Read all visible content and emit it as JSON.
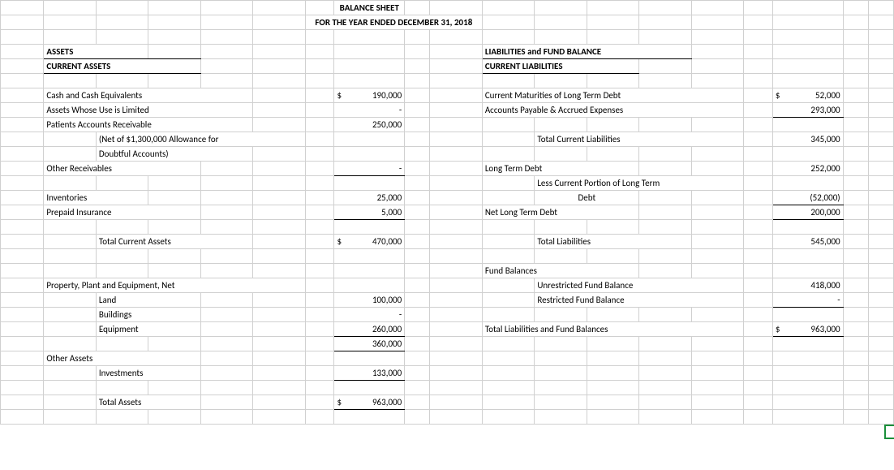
{
  "title": "BALANCE SHEET",
  "subtitle": "FOR THE YEAR ENDED DECEMBER 31, 2018",
  "left": {
    "h1": "ASSETS",
    "h2": "CURRENT ASSETS",
    "cash": "Cash and Cash Equivalents",
    "cash_dol": "$",
    "cash_v": "190,000",
    "ltd": "Assets Whose Use is Limited",
    "ltd_v": "-",
    "par": "Patients Accounts Receivable",
    "par_v": "250,000",
    "parNote1": "(Net of $1,300,000 Allowance for",
    "parNote2": "Doubtful Accounts)",
    "orec": "Other Receivables",
    "orec_v": "-",
    "inv": "Inventories",
    "inv_v": "25,000",
    "prep": "Prepaid Insurance",
    "prep_v": "5,000",
    "tca": "Total Current Assets",
    "tca_dol": "$",
    "tca_v": "470,000",
    "ppe": "Property, Plant and Equipment, Net",
    "land": "Land",
    "land_v": "100,000",
    "bld": "Buildings",
    "bld_v": "-",
    "eq": "Equipment",
    "eq_v": "260,000",
    "ppe_tot": "360,000",
    "oa": "Other Assets",
    "invst": "Investments",
    "invst_v": "133,000",
    "ta": "Total Assets",
    "ta_dol": "$",
    "ta_v": "963,000"
  },
  "right": {
    "h1": "LIABILITIES and FUND BALANCE",
    "h2": "CURRENT LIABILITIES",
    "cmltd": "Current Maturities of Long Term Debt",
    "cmltd_dol": "$",
    "cmltd_v": "52,000",
    "ap": "Accounts Payable & Accrued Expenses",
    "ap_v": "293,000",
    "tcl": "Total Current Liabilities",
    "tcl_v": "345,000",
    "ltdH": "Long Term Debt",
    "ltdH_v": "252,000",
    "lcp1": "Less Current Portion of Long Term",
    "lcp2": "Debt",
    "lcp_v": "(52,000)",
    "nltd": "Net Long Term Debt",
    "nltd_v": "200,000",
    "tl": "Total Liabilities",
    "tl_v": "545,000",
    "fb": "Fund Balances",
    "ufb": "Unrestricted Fund Balance",
    "ufb_v": "418,000",
    "rfb": "Restricted Fund Balance",
    "rfb_v": "-",
    "tlfb": "Total Liabilities and Fund Balances",
    "tlfb_dol": "$",
    "tlfb_v": "963,000"
  }
}
